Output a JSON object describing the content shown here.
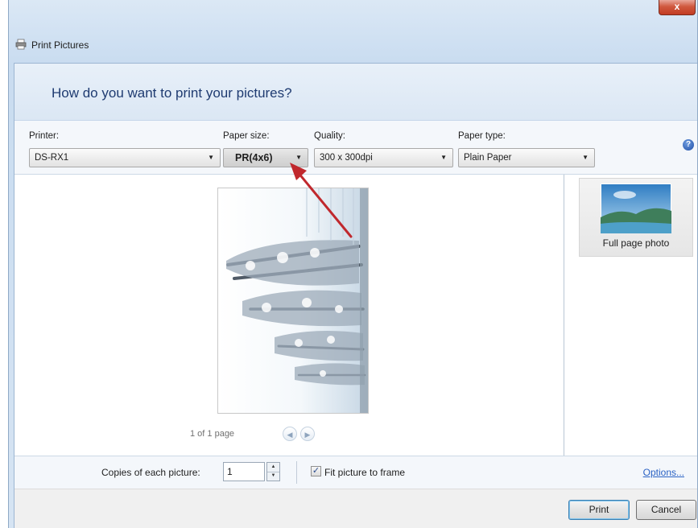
{
  "window": {
    "title": "Print Pictures",
    "close_label": "x"
  },
  "heading": "How do you want to print your pictures?",
  "options": {
    "printer": {
      "label": "Printer:",
      "value": "DS-RX1"
    },
    "paper_size": {
      "label": "Paper size:",
      "value": "PR(4x6)"
    },
    "quality": {
      "label": "Quality:",
      "value": "300 x 300dpi"
    },
    "paper_type": {
      "label": "Paper type:",
      "value": "Plain Paper"
    },
    "help_glyph": "?"
  },
  "preview": {
    "page_counter": "1 of 1 page",
    "prev_glyph": "◀",
    "next_glyph": "▶"
  },
  "layouts": [
    {
      "label": "Full page photo"
    }
  ],
  "bottom": {
    "copies_label": "Copies of each picture:",
    "copies_value": "1",
    "fit_label": "Fit picture to frame",
    "fit_checked": true,
    "options_link": "Options..."
  },
  "footer": {
    "print_label": "Print",
    "cancel_label": "Cancel"
  },
  "annotation": {
    "color": "#c0282d"
  }
}
